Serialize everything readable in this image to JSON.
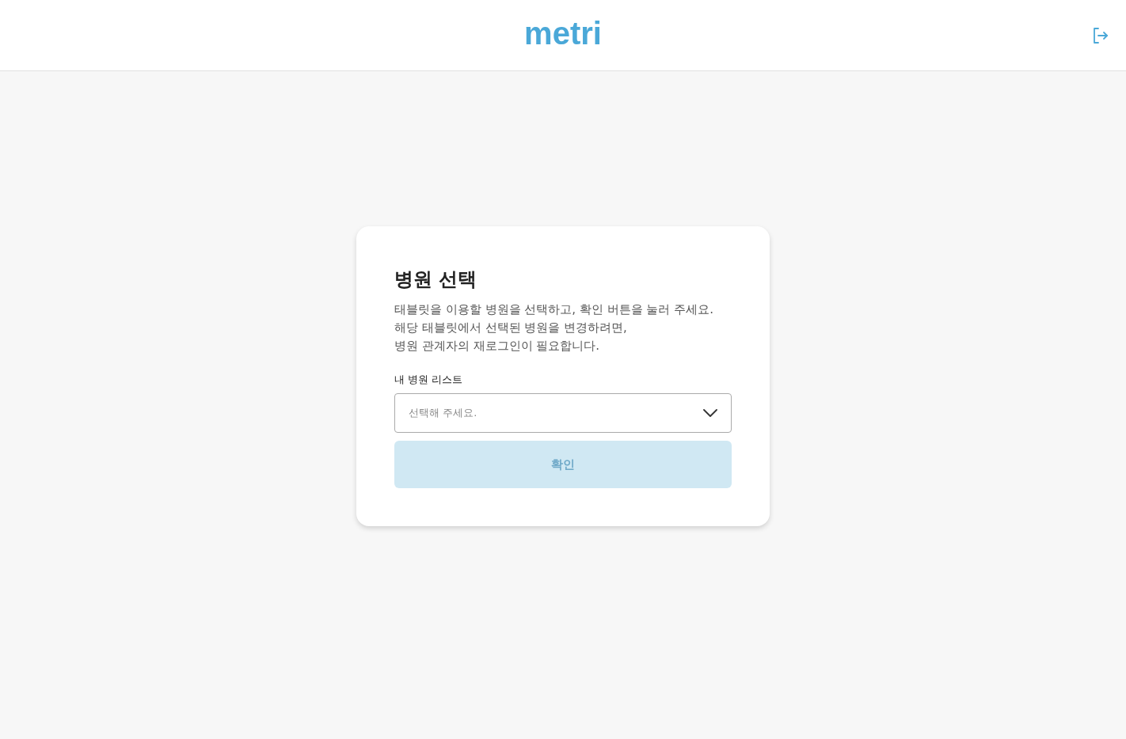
{
  "header": {
    "logo": "metri"
  },
  "card": {
    "title": "병원 선택",
    "description": [
      "태블릿을 이용할 병원을 선택하고, 확인 버튼을 눌러 주세요.",
      "해당 태블릿에서 선택된 병원을 변경하려면,",
      "병원 관계자의 재로그인이 필요합니다."
    ],
    "field": {
      "label": "내 병원 리스트",
      "placeholder": "선택해 주세요."
    },
    "confirm_button": {
      "label": "확인",
      "disabled": true
    }
  }
}
